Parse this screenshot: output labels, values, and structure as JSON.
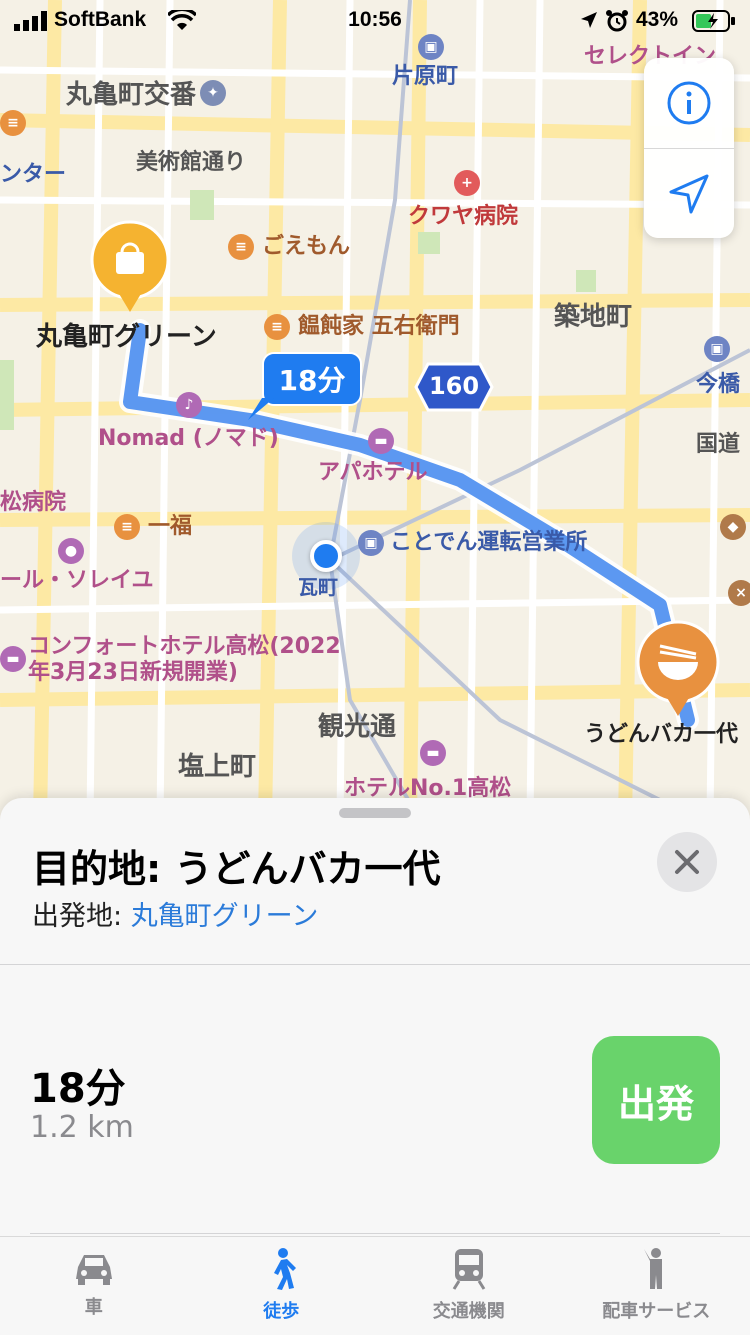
{
  "status_bar": {
    "carrier": "SoftBank",
    "time": "10:56",
    "battery": "43%"
  },
  "map": {
    "labels": {
      "marugame_koban": "丸亀町交番",
      "bijutsukan": "美術館通り",
      "gomon": "ごえもん",
      "kuwaya": "クワヤ病院",
      "katahara": "片原町",
      "select": "セレクトイン",
      "tsukiji": "築地町",
      "imabashi": "今橋",
      "kokudo": "国道",
      "udonya": "饂飩家 五右衛門",
      "nomad": "Nomad (ノマド)",
      "apa": "アパホテル",
      "kotoden": "ことでん運転営業所",
      "kawaramachi": "瓦町",
      "ippuku": "一福",
      "hospital_left": "松病院",
      "soleil": "ール・ソレイユ",
      "comfort_line1": "コンフォートホテル高松(2022",
      "comfort_line2": "年3月23日新規開業)",
      "kankodori": "観光通",
      "shiogami": "塩上町",
      "hotel_no1": "ホテルNo.1高松",
      "center": "ンター",
      "route_badge": "160"
    },
    "origin_pin_label": "丸亀町グリーン",
    "destination_pin_label": "うどんバカ一代",
    "route_time_bubble": "18分"
  },
  "sheet": {
    "destination_prefix": "目的地: ",
    "destination": "うどんバカ一代",
    "origin_prefix": "出発地: ",
    "origin": "丸亀町グリーン",
    "duration": "18分",
    "distance": "1.2 km",
    "go_label": "出発"
  },
  "tabs": [
    {
      "label": "車",
      "icon": "car-icon",
      "active": false
    },
    {
      "label": "徒歩",
      "icon": "walk-icon",
      "active": true
    },
    {
      "label": "交通機関",
      "icon": "train-icon",
      "active": false
    },
    {
      "label": "配車サービス",
      "icon": "ride-share-icon",
      "active": false
    }
  ],
  "colors": {
    "accent": "#1f7cf0",
    "go_button": "#69d36b",
    "route": "#4a8df0",
    "origin_pin": "#f5b330",
    "dest_pin": "#e8913f"
  }
}
